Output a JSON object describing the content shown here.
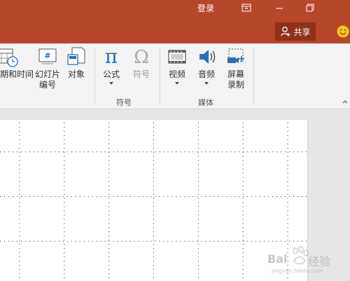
{
  "titlebar": {
    "login_label": "登录",
    "share_label": "共享",
    "brand_color": "#b7472a",
    "share_bg": "#8e3219",
    "buttons": [
      "ribbon-display-icon",
      "minimize-icon",
      "restore-icon"
    ]
  },
  "ribbon": {
    "datetime_label": "日期和时间",
    "slide_number_label_1": "幻灯片",
    "slide_number_label_2": "编号",
    "object_label": "对象",
    "equation_label": "公式",
    "symbol_label": "符号",
    "video_label": "视频",
    "audio_label": "音频",
    "screen_rec_label_1": "屏幕",
    "screen_rec_label_2": "录制",
    "group_symbols": "符号",
    "group_media": "媒体"
  },
  "watermark": {
    "text_1": "Bai",
    "text_2": "经验",
    "url": "jingyan.baidu.com"
  }
}
